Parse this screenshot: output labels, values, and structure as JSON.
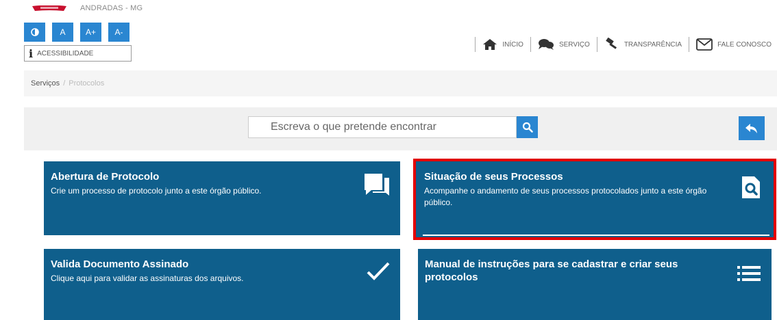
{
  "header": {
    "city": "ANDRADAS - MG",
    "accessibility": {
      "contrast_label": "◐",
      "font_normal": "A",
      "font_increase": "A+",
      "font_decrease": "A-",
      "label": "ACESSIBILIDADE"
    },
    "nav": [
      {
        "label": "INÍCIO",
        "icon": "home-icon"
      },
      {
        "label": "SERVIÇO",
        "icon": "chat-icon"
      },
      {
        "label": "TRANSPARÊNCIA",
        "icon": "gavel-icon"
      },
      {
        "label": "FALE CONOSCO",
        "icon": "envelope-icon"
      }
    ]
  },
  "breadcrumb": [
    "Serviços",
    "Protocolos"
  ],
  "search": {
    "placeholder": "Escreva o que pretende encontrar"
  },
  "cards": [
    {
      "title": "Abertura de Protocolo",
      "description": "Crie um processo de protocolo junto a este órgão público.",
      "icon": "chat-bubble-icon"
    },
    {
      "title": "Situação de seus Processos",
      "description": "Acompanhe o andamento de seus processos protocolados junto a este órgão público.",
      "icon": "file-search-icon"
    },
    {
      "title": "Valida Documento Assinado",
      "description": "Clique aqui para validar as assinaturas dos arquivos.",
      "icon": "check-icon"
    },
    {
      "title": "Manual de instruções para se cadastrar e criar seus protocolos",
      "description": "",
      "icon": "list-icon"
    }
  ],
  "colors": {
    "accent": "#2a86d1",
    "card": "#0f5f8c",
    "highlight": "#e30000"
  }
}
